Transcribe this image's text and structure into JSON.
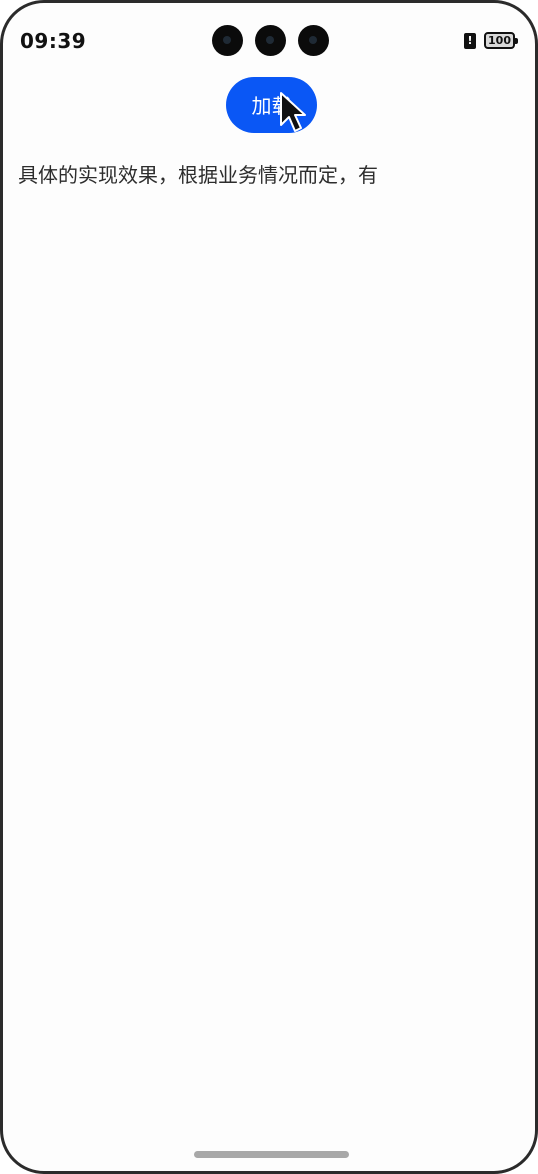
{
  "status_bar": {
    "time": "09:39",
    "alert_symbol": "!",
    "battery_level": "100"
  },
  "main": {
    "load_button_label": "加载",
    "content_text": "具体的实现效果，根据业务情况而定，有"
  },
  "icons": {
    "camera": "camera-icon",
    "alert": "alert-icon",
    "battery": "battery-icon",
    "cursor": "mouse-pointer-icon"
  },
  "colors": {
    "accent": "#0a57f5",
    "text": "#2d2d2d",
    "background": "#fdfdfd"
  }
}
